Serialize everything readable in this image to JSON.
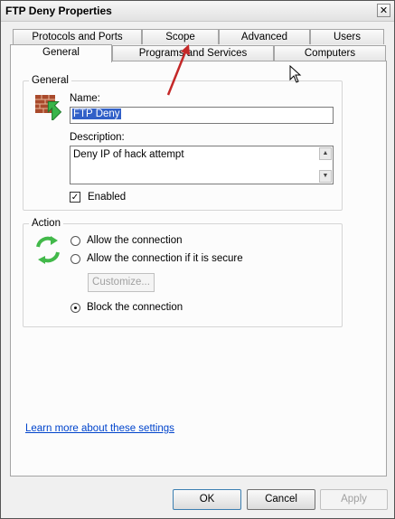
{
  "window": {
    "title": "FTP Deny Properties",
    "close_glyph": "✕"
  },
  "tabs": {
    "back": [
      "Protocols and Ports",
      "Scope",
      "Advanced",
      "Users"
    ],
    "front": [
      "General",
      "Programs and Services",
      "Computers"
    ]
  },
  "general": {
    "legend": "General",
    "name_label": "Name:",
    "name_value": "FTP Deny",
    "description_label": "Description:",
    "description_value": "Deny IP of hack attempt",
    "enabled_label": "Enabled",
    "enabled_checked": true
  },
  "action": {
    "legend": "Action",
    "options": [
      "Allow the connection",
      "Allow the connection if it is secure",
      "Block the connection"
    ],
    "selected": "Block the connection",
    "customize_label": "Customize..."
  },
  "link": "Learn more about these settings",
  "buttons": {
    "ok": "OK",
    "cancel": "Cancel",
    "apply": "Apply"
  },
  "icons": [
    "firewall-rule-icon",
    "green-arrows-icon",
    "close-icon",
    "cursor-icon",
    "red-arrow-annotation"
  ]
}
